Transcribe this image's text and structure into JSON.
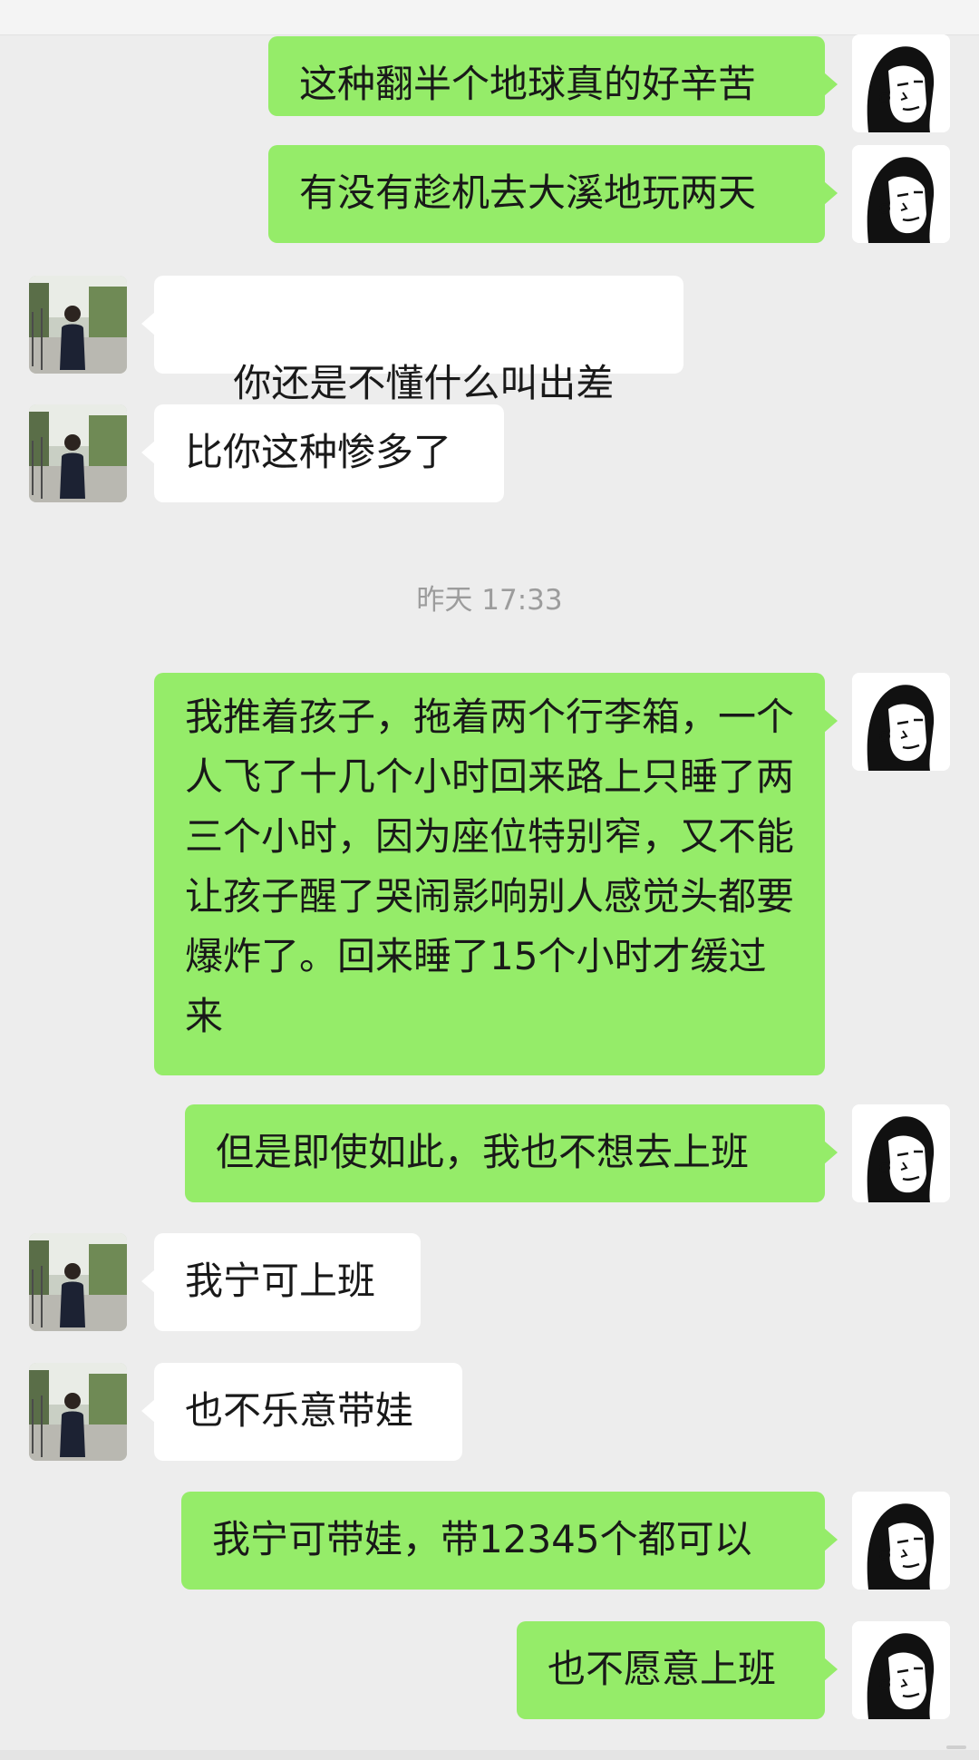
{
  "timestamp": "昨天 17:33",
  "messages": [
    {
      "from": "me",
      "text": "这种翻半个地球真的好辛苦"
    },
    {
      "from": "me",
      "text": "有没有趁机去大溪地玩两天"
    },
    {
      "from": "other",
      "text": "你还是不懂什么叫出差",
      "emoji": "sweat-face-emoji"
    },
    {
      "from": "other",
      "text": "比你这种惨多了"
    },
    {
      "from": "me",
      "text": "我推着孩子，拖着两个行李箱，一个人飞了十几个小时回来路上只睡了两三个小时，因为座位特别窄，又不能让孩子醒了哭闹影响别人感觉头都要爆炸了。回来睡了15个小时才缓过来"
    },
    {
      "from": "me",
      "text": "但是即使如此，我也不想去上班"
    },
    {
      "from": "other",
      "text": "我宁可上班"
    },
    {
      "from": "other",
      "text": "也不乐意带娃"
    },
    {
      "from": "me",
      "text": "我宁可带娃，带12345个都可以"
    },
    {
      "from": "me",
      "text": "也不愿意上班"
    }
  ],
  "colors": {
    "me_bubble": "#95ec69",
    "other_bubble": "#ffffff",
    "background": "#ededed"
  }
}
